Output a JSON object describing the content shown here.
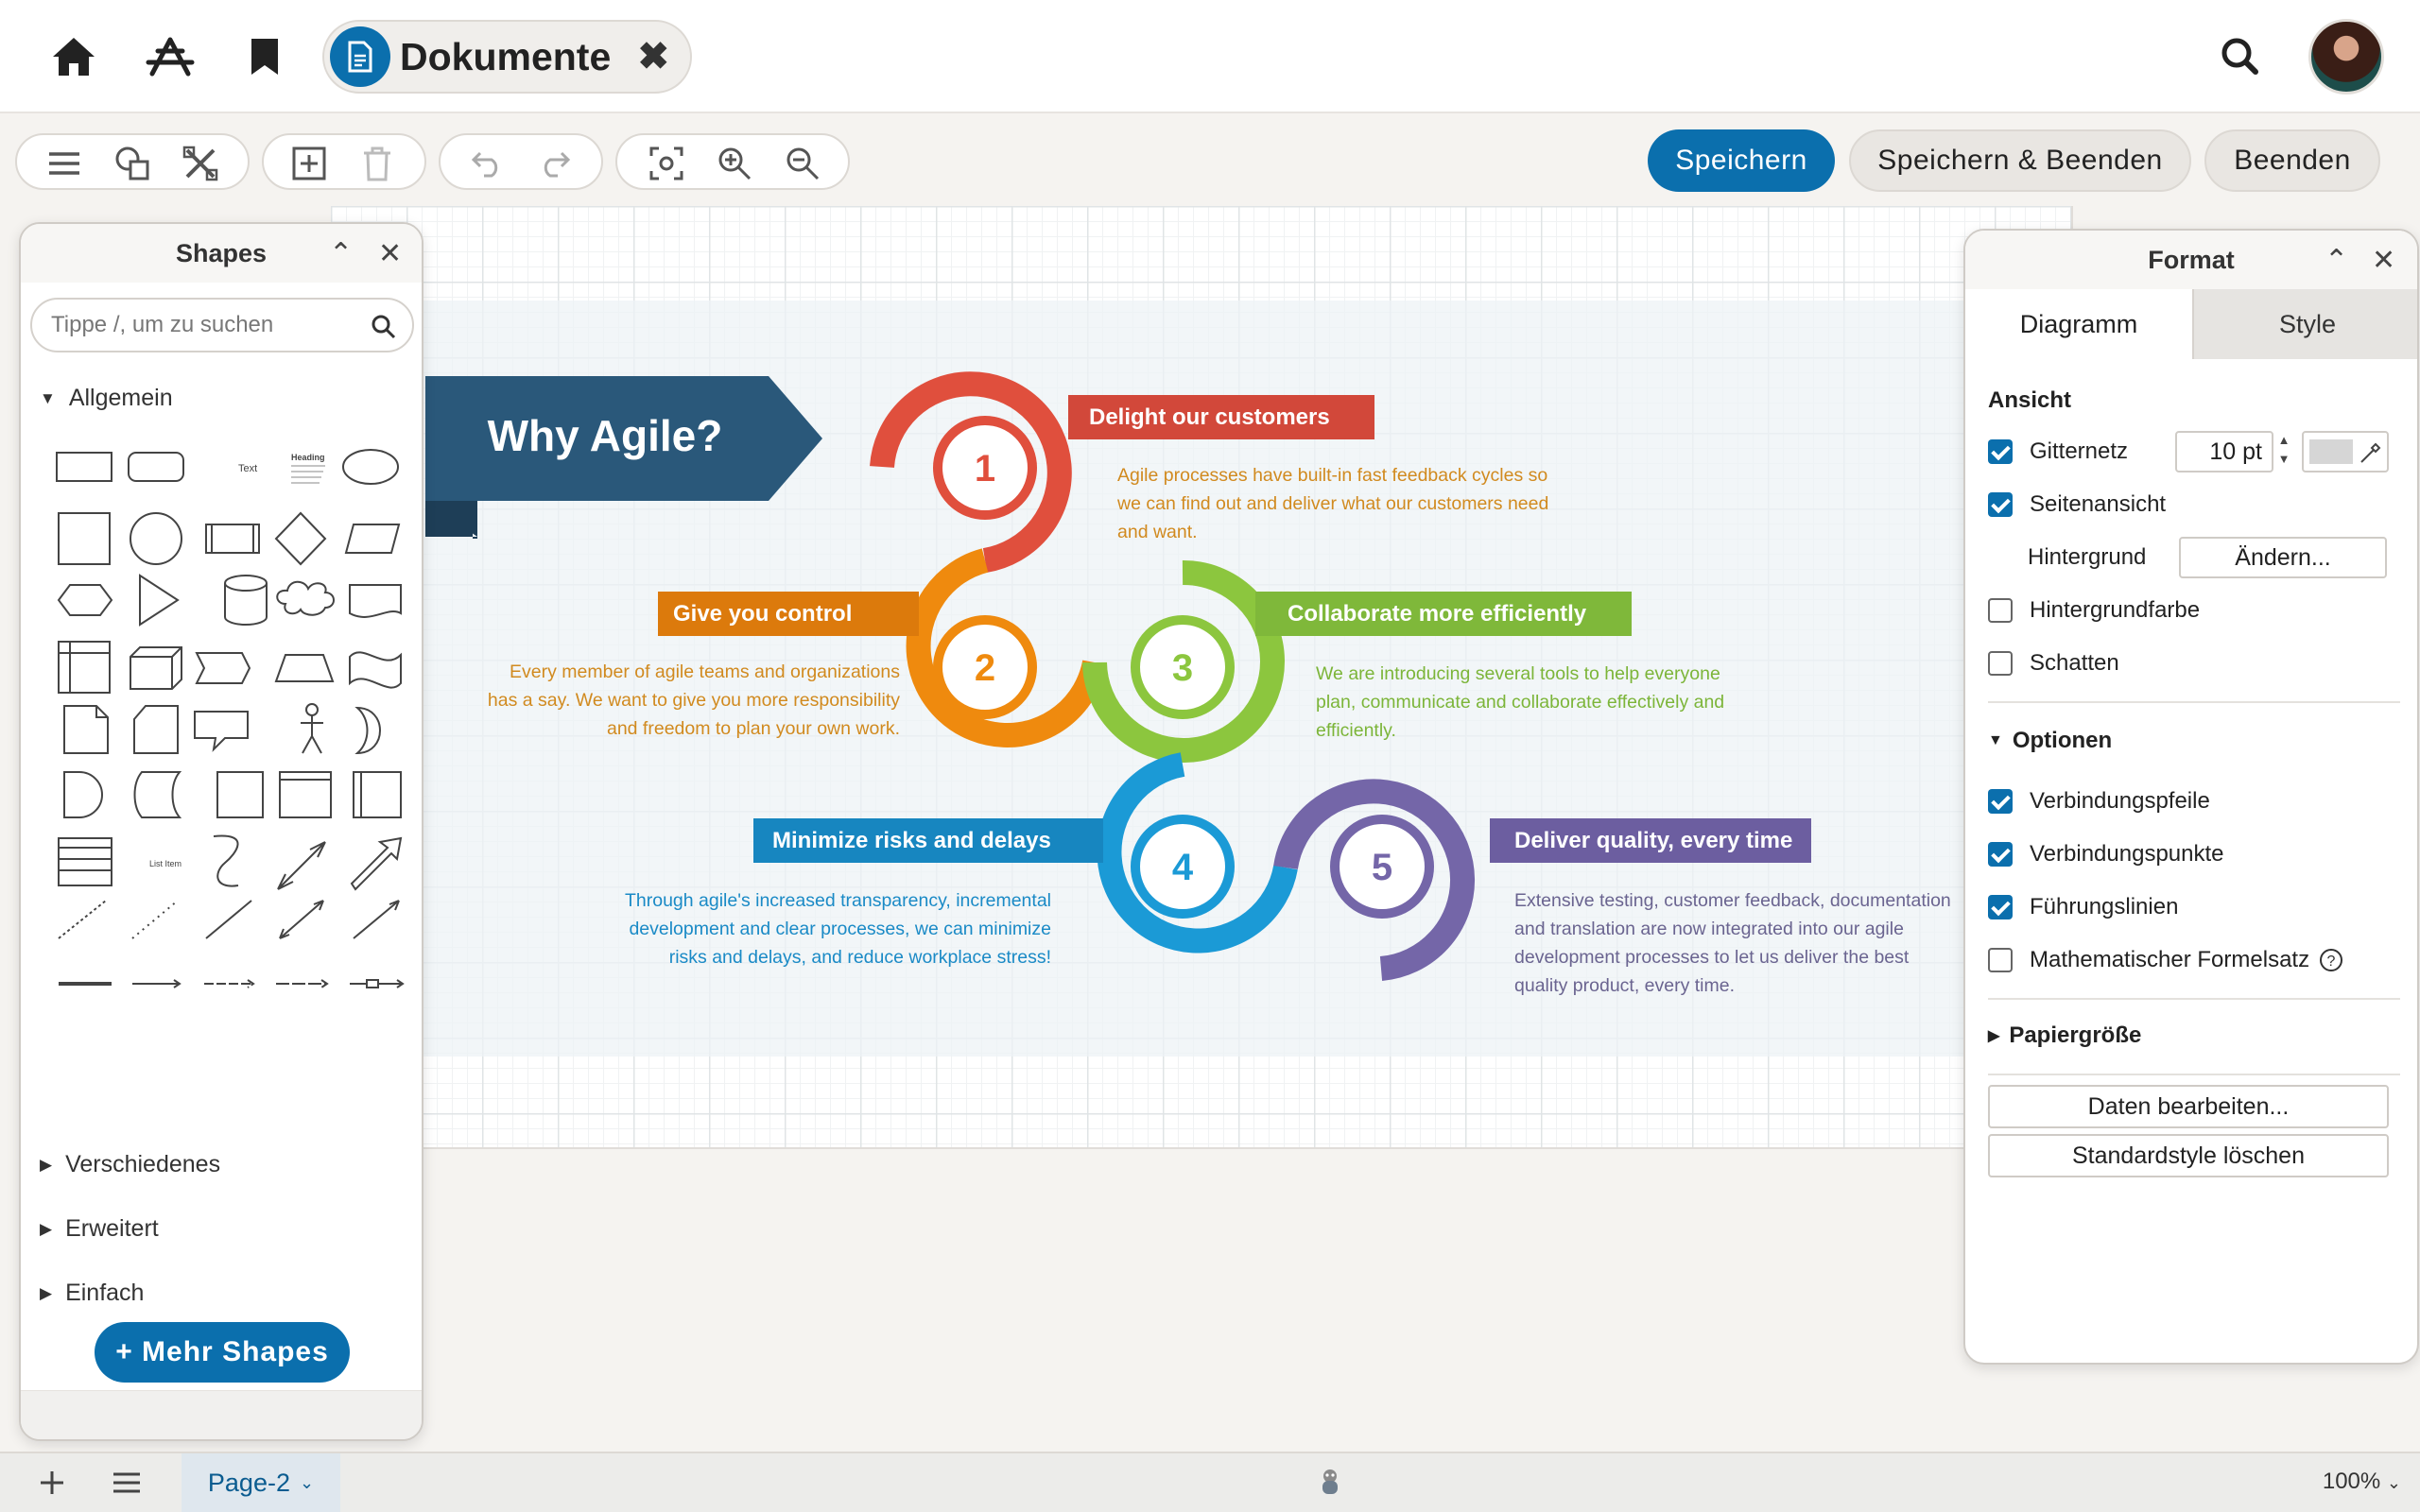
{
  "topbar": {
    "document_title": "Dokumente",
    "icons": [
      "home-icon",
      "app-store-icon",
      "bookmark-icon",
      "document-icon",
      "close-icon",
      "search-icon",
      "avatar"
    ]
  },
  "toolbar": {
    "save_label": "Speichern",
    "save_exit_label": "Speichern & Beenden",
    "exit_label": "Beenden"
  },
  "shapes_panel": {
    "title": "Shapes",
    "search_placeholder": "Tippe /, um zu suchen",
    "sections": {
      "general": "Allgemein",
      "misc": "Verschiedenes",
      "advanced": "Erweitert",
      "basic": "Einfach"
    },
    "shape_text_label": "Text",
    "shape_heading_label": "Heading",
    "shape_list_item_label": "List Item",
    "more_shapes_label": "+ Mehr Shapes"
  },
  "infographic": {
    "title": "Why Agile?",
    "items": [
      {
        "number": "1",
        "heading": "Delight our customers",
        "color": "#e04f3d",
        "text": [
          "Agile processes have built-in fast feedback cycles so",
          "we can find out and deliver what our customers need",
          "and want."
        ]
      },
      {
        "number": "2",
        "heading": "Give you control",
        "color": "#ef8a0e",
        "text": [
          "Every member of agile teams and organizations",
          "has a say. We want to give you more responsibility",
          "and freedom to plan your own work."
        ]
      },
      {
        "number": "3",
        "heading": "Collaborate more efficiently",
        "color": "#8cc63e",
        "text": [
          "We are introducing several tools to help everyone",
          "plan, communicate and collaborate effectively and",
          "efficiently."
        ]
      },
      {
        "number": "4",
        "heading": "Minimize risks and delays",
        "color": "#1b9ad6",
        "text": [
          "Through agile's increased transparency, incremental",
          "development and clear processes, we can minimize",
          "risks and delays, and reduce workplace stress!"
        ]
      },
      {
        "number": "5",
        "heading": "Deliver quality, every time",
        "color": "#7466a8",
        "text": [
          "Extensive testing, customer feedback, documentation",
          "and translation are now integrated into our agile",
          "development processes to let us deliver the best",
          "quality product, every time."
        ]
      }
    ]
  },
  "format_panel": {
    "title": "Format",
    "tabs": {
      "diagram": "Diagramm",
      "style": "Style"
    },
    "view": {
      "heading": "Ansicht",
      "grid": "Gitternetz",
      "grid_size": "10 pt",
      "page_view": "Seitenansicht",
      "background": "Hintergrund",
      "change_button": "Ändern...",
      "background_color": "Hintergrundfarbe",
      "shadow": "Schatten"
    },
    "options": {
      "heading": "Optionen",
      "connection_arrows": "Verbindungspfeile",
      "connection_points": "Verbindungspunkte",
      "guides": "Führungslinien",
      "math_typesetting": "Mathematischer Formelsatz"
    },
    "paper_size": "Papiergröße",
    "edit_data_button": "Daten bearbeiten...",
    "clear_style_button": "Standardstyle löschen"
  },
  "statusbar": {
    "page_tab": "Page-2",
    "zoom": "100%"
  },
  "colors": {
    "accent": "#0b6fad",
    "banner_title": "#2a587a"
  }
}
